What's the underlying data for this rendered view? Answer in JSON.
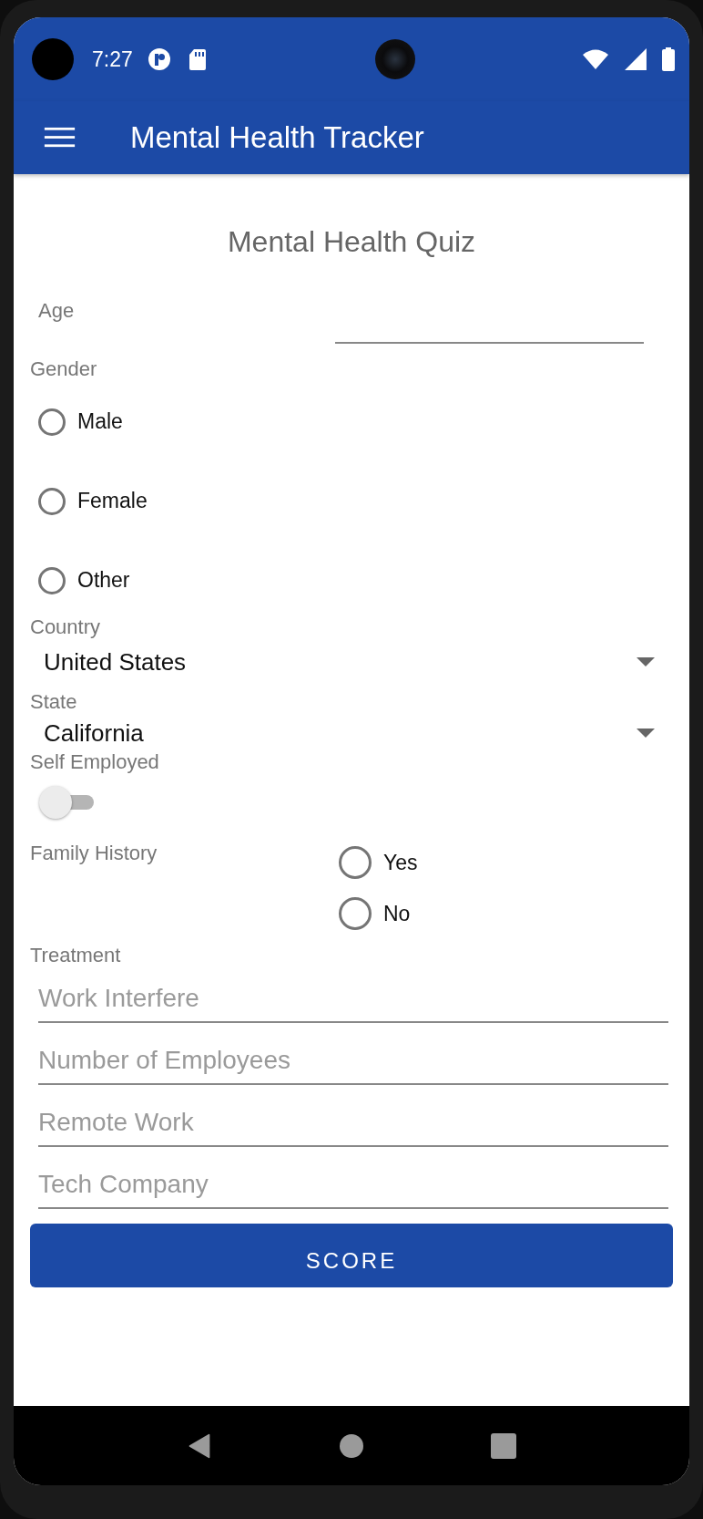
{
  "status_bar": {
    "time": "7:27"
  },
  "app_bar": {
    "title": "Mental Health Tracker"
  },
  "quiz_title": "Mental Health Quiz",
  "age": {
    "label": "Age"
  },
  "gender": {
    "label": "Gender",
    "options": [
      {
        "label": "Male",
        "selected": false
      },
      {
        "label": "Female",
        "selected": false
      },
      {
        "label": "Other",
        "selected": false
      }
    ]
  },
  "country": {
    "label": "Country",
    "value": "United States"
  },
  "state": {
    "label": "State",
    "value": "California"
  },
  "self_employed": {
    "label": "Self Employed",
    "on": false
  },
  "family_history": {
    "label": "Family History",
    "options": [
      {
        "label": "Yes",
        "selected": false
      },
      {
        "label": "No",
        "selected": false
      }
    ]
  },
  "treatment": {
    "label": "Treatment"
  },
  "fields": [
    {
      "placeholder": "Work Interfere"
    },
    {
      "placeholder": "Number of Employees"
    },
    {
      "placeholder": "Remote Work"
    },
    {
      "placeholder": "Tech Company"
    }
  ],
  "button": "SCORE"
}
